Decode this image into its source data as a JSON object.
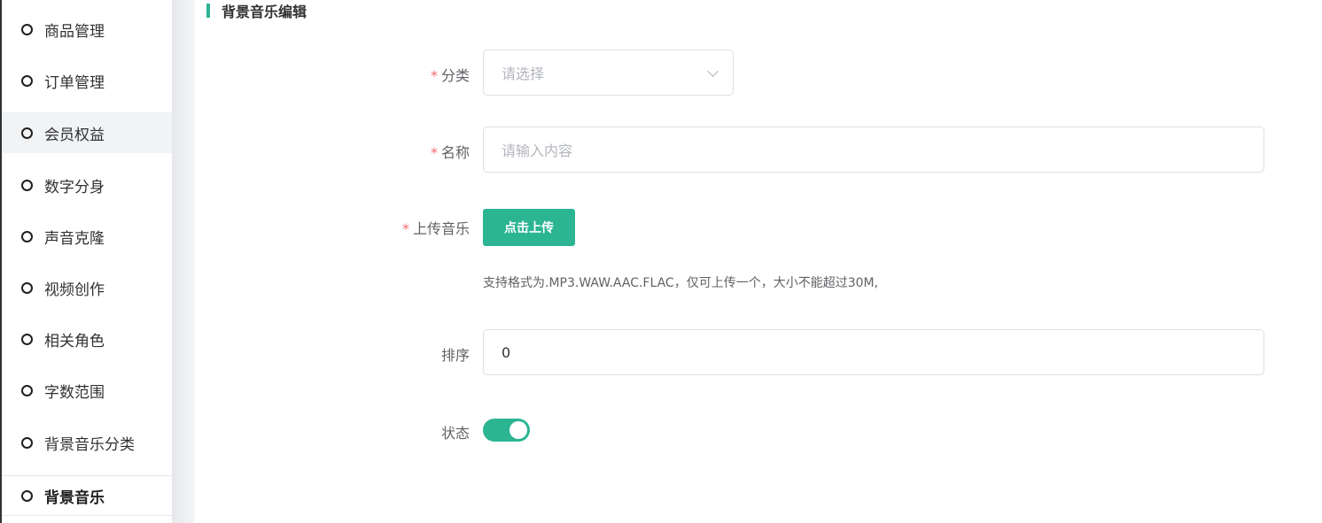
{
  "sidebar": {
    "items": [
      {
        "label": "商品管理"
      },
      {
        "label": "订单管理"
      },
      {
        "label": "会员权益"
      },
      {
        "label": "数字分身"
      },
      {
        "label": "声音克隆"
      },
      {
        "label": "视频创作"
      },
      {
        "label": "相关角色"
      },
      {
        "label": "字数范围"
      },
      {
        "label": "背景音乐分类"
      },
      {
        "label": "背景音乐"
      }
    ]
  },
  "main": {
    "title": "背景音乐编辑",
    "form": {
      "required_mark": "*",
      "category": {
        "label": "分类",
        "placeholder": "请选择"
      },
      "name": {
        "label": "名称",
        "placeholder": "请输入内容"
      },
      "upload": {
        "label": "上传音乐",
        "button_label": "点击上传",
        "hint": "支持格式为.MP3.WAW.AAC.FLAC，仅可上传一个，大小不能超过30M,"
      },
      "sort": {
        "label": "排序",
        "value": "0"
      },
      "status": {
        "label": "状态",
        "enabled": true
      }
    }
  },
  "colors": {
    "accent": "#2bb593",
    "required": "#f56c6c"
  }
}
